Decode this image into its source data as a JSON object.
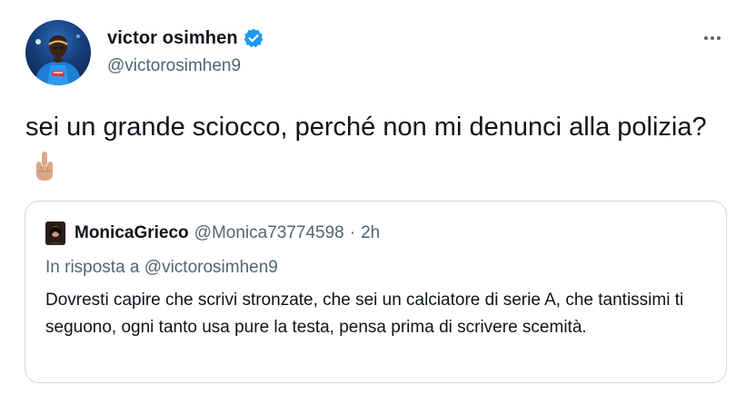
{
  "author": {
    "name": "victor osimhen",
    "handle": "@victorosimhen9",
    "verified": true,
    "avatar_icon": "profile-photo-napoli-kit",
    "verified_color": "#1d9bf0"
  },
  "tweet": {
    "text": "sei un grande sciocco, perché non mi denunci alla polizia?",
    "emoji": "middle-finger-emoji"
  },
  "menu": {
    "icon": "more-options-icon"
  },
  "quoted_tweet": {
    "name": "MonicaGrieco",
    "handle": "@Monica73774598",
    "separator": "·",
    "time": "2h",
    "reply_prefix": "In risposta a",
    "reply_mention": "@victorosimhen9",
    "text": "Dovresti capire che scrivi stronzate, che sei un calciatore di serie A, che tantissimi ti seguono, ogni tanto usa pure la testa, pensa prima di scrivere scemità."
  },
  "colors": {
    "text_primary": "#0f1419",
    "text_secondary": "#536471",
    "border": "#cfd9de",
    "accent": "#1d9bf0"
  }
}
